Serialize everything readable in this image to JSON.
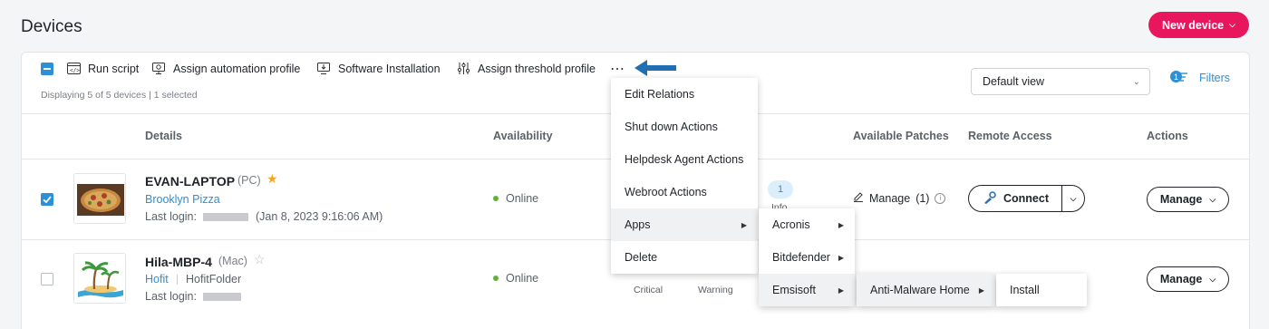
{
  "page": {
    "title": "Devices",
    "new_device_label": "New device"
  },
  "toolbar": {
    "run_script": "Run script",
    "assign_automation_profile": "Assign automation profile",
    "software_installation": "Software Installation",
    "assign_threshold_profile": "Assign threshold profile",
    "more": "⋯",
    "displaying": "Displaying 5 of 5 devices | 1 selected",
    "view_value": "Default view",
    "filters_label": "Filters",
    "filters_count": "1"
  },
  "table": {
    "headers": {
      "details": "Details",
      "availability": "Availability",
      "available_patches": "Available Patches",
      "remote_access": "Remote Access",
      "actions": "Actions"
    },
    "rows": [
      {
        "name": "EVAN-LAPTOP",
        "type": "(PC)",
        "customer": "Brooklyn Pizza",
        "last_login_label": "Last login:",
        "last_login_date": "(Jan 8, 2023 9:16:06 AM)",
        "availability": "Online",
        "selected": true,
        "favorite": true,
        "info_count": "1",
        "info_label": "Info",
        "patches": "Manage",
        "patches_count": "(1)",
        "connect_label": "Connect",
        "manage_label": "Manage"
      },
      {
        "name": "Hila-MBP-4",
        "type": "(Mac)",
        "customer": "Hofit",
        "folder": "HofitFolder",
        "last_login_label": "Last login:",
        "availability": "Online",
        "selected": false,
        "favorite": false,
        "critical_label": "Critical",
        "warning_label": "Warning",
        "manage_label": "Manage"
      }
    ]
  },
  "more_menu": {
    "items": [
      "Edit Relations",
      "Shut down Actions",
      "Helpdesk Agent Actions",
      "Webroot Actions",
      "Apps",
      "Delete"
    ],
    "apps_submenu": [
      "Acronis",
      "Bitdefender",
      "Emsisoft"
    ],
    "emsisoft_submenu": [
      "Anti-Malware Home"
    ],
    "anti_malware_submenu": [
      "Install"
    ]
  },
  "colors": {
    "accent": "#2d8fd5",
    "brand": "#e8175d",
    "online": "#5fb336",
    "favorite": "#f5a623"
  }
}
